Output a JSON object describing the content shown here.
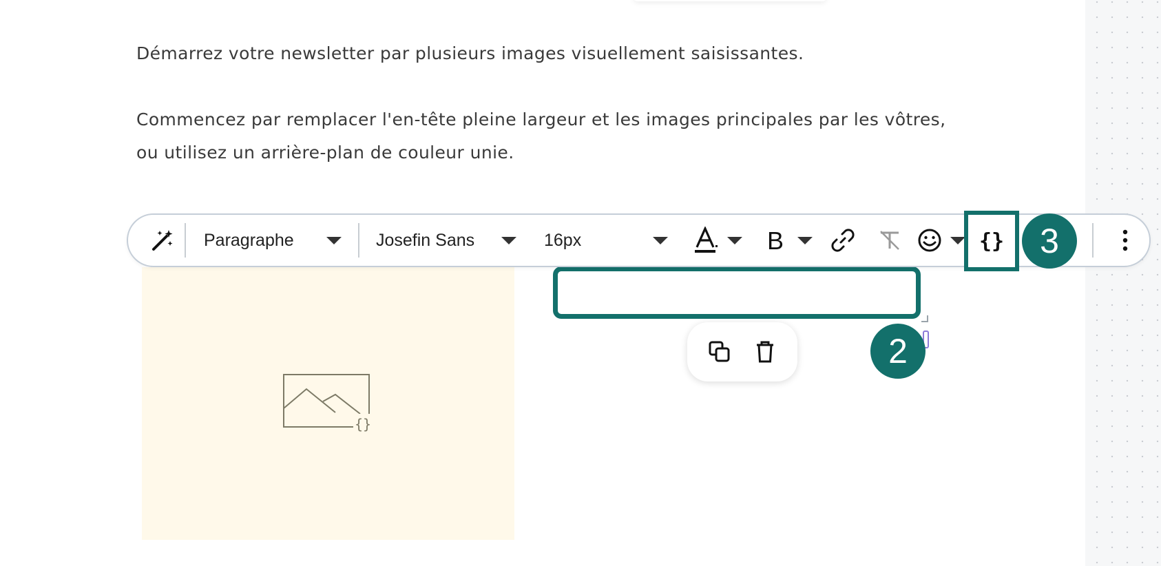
{
  "content": {
    "paragraph_1": "Démarrez votre newsletter par plusieurs images visuellement saisissantes.",
    "paragraph_2": "Commencez par remplacer l'en-tête pleine largeur et les images principales par les vôtres, ou utilisez un arrière-plan de couleur unie."
  },
  "toolbar": {
    "block_type": "Paragraphe",
    "font_family": "Josefin Sans",
    "font_size": "16px",
    "icons": [
      "magic-wand-icon",
      "text-color-icon",
      "bold-icon",
      "link-icon",
      "clear-formatting-icon",
      "emoji-icon",
      "variable-icon",
      "more-vertical-icon"
    ],
    "variable_label": "{}"
  },
  "image_block": {
    "background": "#fff9ea",
    "icon": "image-variable-icon"
  },
  "block_actions": {
    "icons": [
      "duplicate-icon",
      "trash-icon"
    ]
  },
  "badges": {
    "step_2": "2",
    "step_3": "3"
  },
  "colors": {
    "accent": "#13706b",
    "toolbar_border": "#c5ced8",
    "text": "#3a3a3a"
  }
}
